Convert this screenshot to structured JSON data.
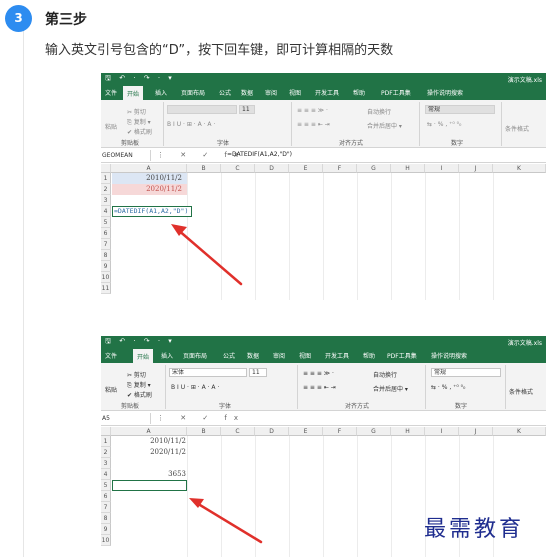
{
  "step": {
    "number": "3",
    "title": "第三步",
    "instruction": "输入英文引号包含的“D”，按下回车键，即可计算相隔的天数"
  },
  "excel": {
    "quick_access": "🖫 ↶ · ↷ · ▾",
    "doc_title": "演示文稿.xls",
    "tabs": [
      "文件",
      "开始",
      "插入",
      "页面布局",
      "公式",
      "数据",
      "审阅",
      "视图",
      "开发工具",
      "帮助",
      "PDF工具集",
      "操作说明搜索"
    ],
    "ribbon": {
      "paste": "粘贴",
      "cut": "✂ 剪切",
      "copy": "⎘ 复制 ▾",
      "format_painter": "✔ 格式刷",
      "clipboard_group": "剪贴板",
      "font_group": "字体",
      "align_group": "对齐方式",
      "number_group": "数字",
      "wrap_text": "自动换行",
      "merge_center": "合并后居中 ▾",
      "cond_format": "条件格式",
      "bold_italic_underline": "B  I  U  ·  ⊞ ·  A ·  A ·",
      "align_row1": "≡ ≡ ≡   ≫ ·",
      "align_row2": "≡ ≡ ≡   ⇤ ⇥",
      "percent_row": "⇆ · %  ,  ⁺⁰ ⁰₀"
    },
    "columns": [
      "A",
      "B",
      "C",
      "D",
      "E",
      "F",
      "G",
      "H",
      "I",
      "J",
      "K"
    ]
  },
  "screenshot1": {
    "font_name": "",
    "font_size": "11",
    "number_format": "常规",
    "name_box": "GEOMEAN",
    "fx_icons": "⋮ ✕ ✓ fx",
    "formula": "=DATEDIF(A1,A2,\"D\")",
    "a1": "2010/11/2",
    "a2": "2020/11/2",
    "a4": "=DATEDIF(A1,A2,\"D\")",
    "rows": [
      "1",
      "2",
      "3",
      "4",
      "5",
      "6",
      "7",
      "8",
      "9",
      "10",
      "11"
    ]
  },
  "screenshot2": {
    "font_name": "宋体",
    "font_size": "11",
    "number_format": "常规",
    "name_box": "A5",
    "fx_icons": "⋮ ✕ ✓ fx",
    "formula": "",
    "a1": "2010/11/2",
    "a2": "2020/11/2",
    "a4": "3653",
    "rows": [
      "1",
      "2",
      "3",
      "4",
      "5",
      "6",
      "7",
      "8",
      "9",
      "10"
    ]
  },
  "watermark": "最需教育",
  "colors": {
    "excel_green": "#217346",
    "badge_blue": "#2d8cf0",
    "arrow_red": "#e0302b",
    "watermark_blue": "#1f2d8f"
  }
}
